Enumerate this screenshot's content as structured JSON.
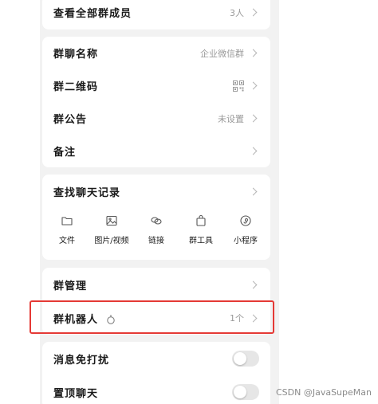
{
  "members_row": {
    "label": "查看全部群成员",
    "value": "3人"
  },
  "info_rows": [
    {
      "label": "群聊名称",
      "value": "企业微信群"
    },
    {
      "label": "群二维码"
    },
    {
      "label": "群公告",
      "value": "未设置"
    },
    {
      "label": "备注"
    }
  ],
  "history": {
    "label": "查找聊天记录",
    "tools": [
      {
        "label": "文件",
        "icon": "folder-icon"
      },
      {
        "label": "图片/视频",
        "icon": "image-icon"
      },
      {
        "label": "链接",
        "icon": "link-icon"
      },
      {
        "label": "群工具",
        "icon": "bag-icon"
      },
      {
        "label": "小程序",
        "icon": "mini-program-icon"
      }
    ]
  },
  "manage": {
    "admin_label": "群管理",
    "robot_label": "群机器人",
    "robot_value": "1个"
  },
  "settings": {
    "mute_label": "消息免打扰",
    "pin_label": "置顶聊天"
  },
  "watermark": "CSDN @JavaSupeMan",
  "colors": {
    "highlight": "#e53935",
    "panel_bg": "#f2f2f2",
    "muted_text": "#9a9a9a"
  }
}
